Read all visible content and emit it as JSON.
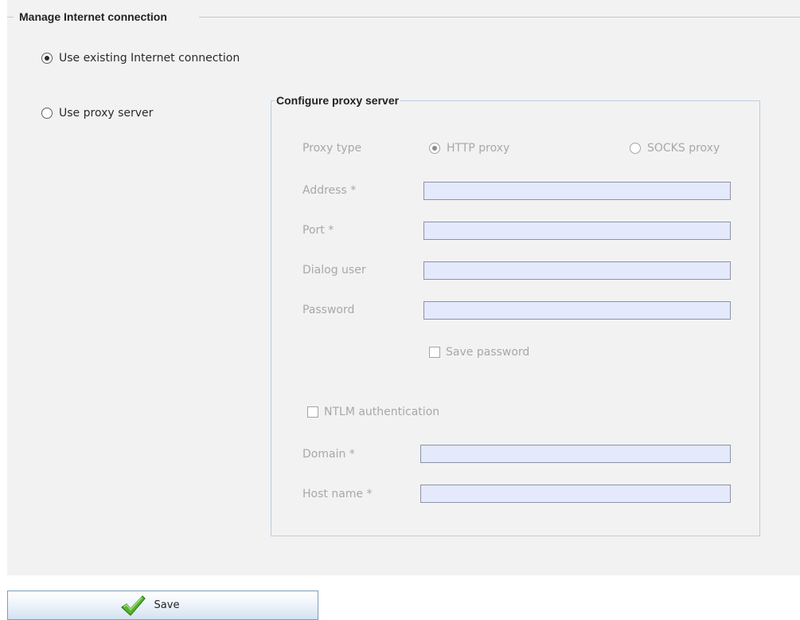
{
  "section": {
    "title": "Manage Internet connection"
  },
  "connection_options": {
    "existing": {
      "label": "Use existing Internet connection",
      "selected": true
    },
    "proxy": {
      "label": "Use proxy server",
      "selected": false
    }
  },
  "proxy_config": {
    "title": "Configure proxy server",
    "proxy_type_label": "Proxy type",
    "http_label": "HTTP proxy",
    "socks_label": "SOCKS proxy",
    "selected_type": "HTTP proxy",
    "address_label": "Address *",
    "address_value": "",
    "port_label": "Port *",
    "port_value": "",
    "user_label": "Dialog user",
    "user_value": "",
    "password_label": "Password",
    "password_value": "",
    "save_password_label": "Save password",
    "save_password_checked": false,
    "ntlm_label": "NTLM authentication",
    "ntlm_checked": false,
    "domain_label": "Domain *",
    "domain_value": "",
    "host_label": "Host name *",
    "host_value": ""
  },
  "actions": {
    "save_label": "Save",
    "save_icon": "checkmark-icon"
  },
  "colors": {
    "panel_background": "#f2f2f2",
    "input_background": "#e4e9fb",
    "inner_border": "#b9cde0",
    "checkmark": "#4caf2a"
  }
}
